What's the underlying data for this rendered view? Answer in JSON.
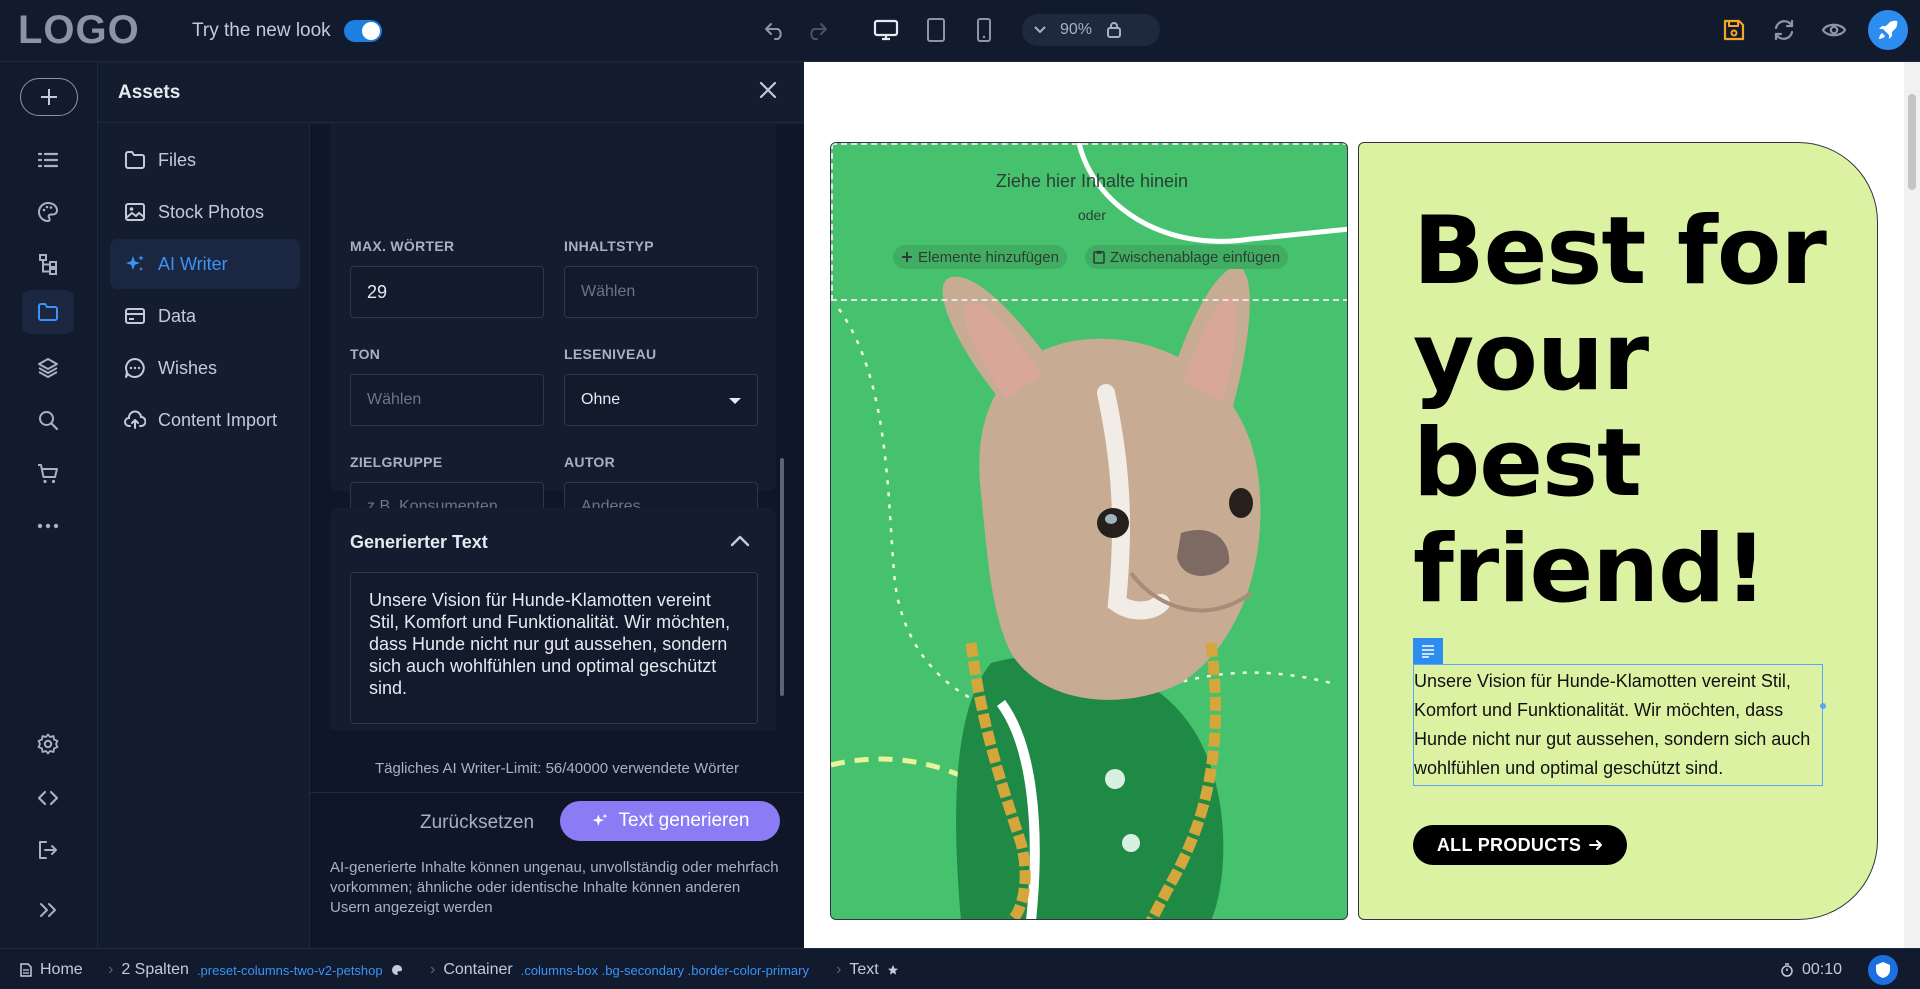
{
  "topbar": {
    "logo": "LOGO",
    "try_new_look": "Try the new look",
    "zoom": "90%"
  },
  "assets": {
    "title": "Assets",
    "nav": [
      {
        "label": "Files",
        "icon": "folder-icon"
      },
      {
        "label": "Stock Photos",
        "icon": "image-icon"
      },
      {
        "label": "AI Writer",
        "icon": "sparkles-icon"
      },
      {
        "label": "Data",
        "icon": "card-icon"
      },
      {
        "label": "Wishes",
        "icon": "chat-icon"
      },
      {
        "label": "Content Import",
        "icon": "cloud-upload-icon"
      }
    ],
    "fields": {
      "max_words_label": "MAX. WÖRTER",
      "max_words_value": "29",
      "content_type_label": "INHALTSTYP",
      "content_type_placeholder": "Wählen",
      "tone_label": "TON",
      "tone_placeholder": "Wählen",
      "reading_level_label": "LESENIVEAU",
      "reading_level_value": "Ohne",
      "audience_label": "ZIELGRUPPE",
      "audience_placeholder": "z.B. Konsumenten",
      "author_label": "AUTOR",
      "author_placeholder": "Anderes"
    },
    "generated": {
      "title": "Generierter Text",
      "text": "Unsere Vision für Hunde-Klamotten vereint Stil, Komfort und Funktionalität. Wir möchten, dass Hunde nicht nur gut aussehen, sondern sich auch wohlfühlen und optimal geschützt sind."
    },
    "limit": "Tägliches AI Writer-Limit: 56/40000 verwendete Wörter",
    "reset_label": "Zurücksetzen",
    "generate_label": "Text generieren",
    "disclaimer": "AI-generierte Inhalte können ungenau, unvollständig oder mehrfach vorkommen; ähnliche oder identische Inhalte können anderen Usern angezeigt werden"
  },
  "canvas": {
    "dropzone_text": "Ziehe hier Inhalte hinein",
    "dropzone_or": "oder",
    "add_elements": "Elemente hinzufügen",
    "paste_clipboard": "Zwischenablage einfügen",
    "headline": "Best for your best friend!",
    "body": "Unsere Vision für Hunde-Klamotten vereint Stil, Komfort und Funktionalität. Wir möchten, dass Hunde nicht nur gut aussehen, sondern sich auch wohlfühlen und optimal geschützt sind.",
    "button": "ALL PRODUCTS"
  },
  "statusbar": {
    "home": "Home",
    "spalten": "2 Spalten",
    "spalten_class": ".preset-columns-two-v2-petshop",
    "container": "Container",
    "container_class": ".columns-box .bg-secondary .border-color-primary",
    "text": "Text",
    "time": "00:10"
  },
  "colors": {
    "accent": "#2d8cf0",
    "generate_button": "#8b7cf6",
    "canvas_green": "#46c26f",
    "canvas_lime": "#dcf2a3"
  }
}
